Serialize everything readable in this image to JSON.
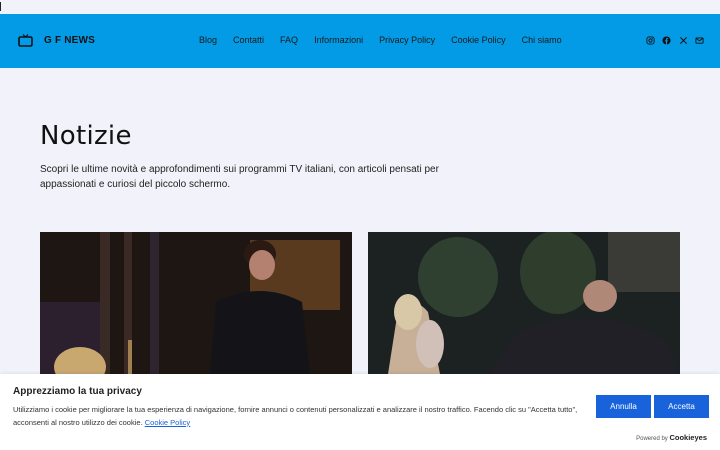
{
  "header": {
    "brand": "G F NEWS",
    "nav": [
      "Blog",
      "Contatti",
      "FAQ",
      "Informazioni",
      "Privacy Policy",
      "Cookie Policy",
      "Chi siamo"
    ],
    "social": [
      "instagram-icon",
      "facebook-icon",
      "x-icon",
      "mail-icon"
    ],
    "bg_color": "#039be5"
  },
  "main": {
    "title": "Notizie",
    "intro": "Scopri le ultime novità e approfondimenti sui programmi TV italiani, con articoli pensati per appassionati e curiosi del piccolo schermo."
  },
  "cookie": {
    "title": "Apprezziamo la tua privacy",
    "text": "Utilizziamo i cookie per migliorare la tua esperienza di navigazione, fornire annunci o contenuti personalizzati e analizzare il nostro traffico. Facendo clic su \"Accetta tutto\", acconsenti al nostro utilizzo dei cookie.",
    "link": "Cookie Policy",
    "reject_label": "Annulla",
    "accept_label": "Accetta",
    "powered_prefix": "Powered by",
    "powered_brand": "Cookieyes",
    "accent_color": "#1863dc"
  }
}
